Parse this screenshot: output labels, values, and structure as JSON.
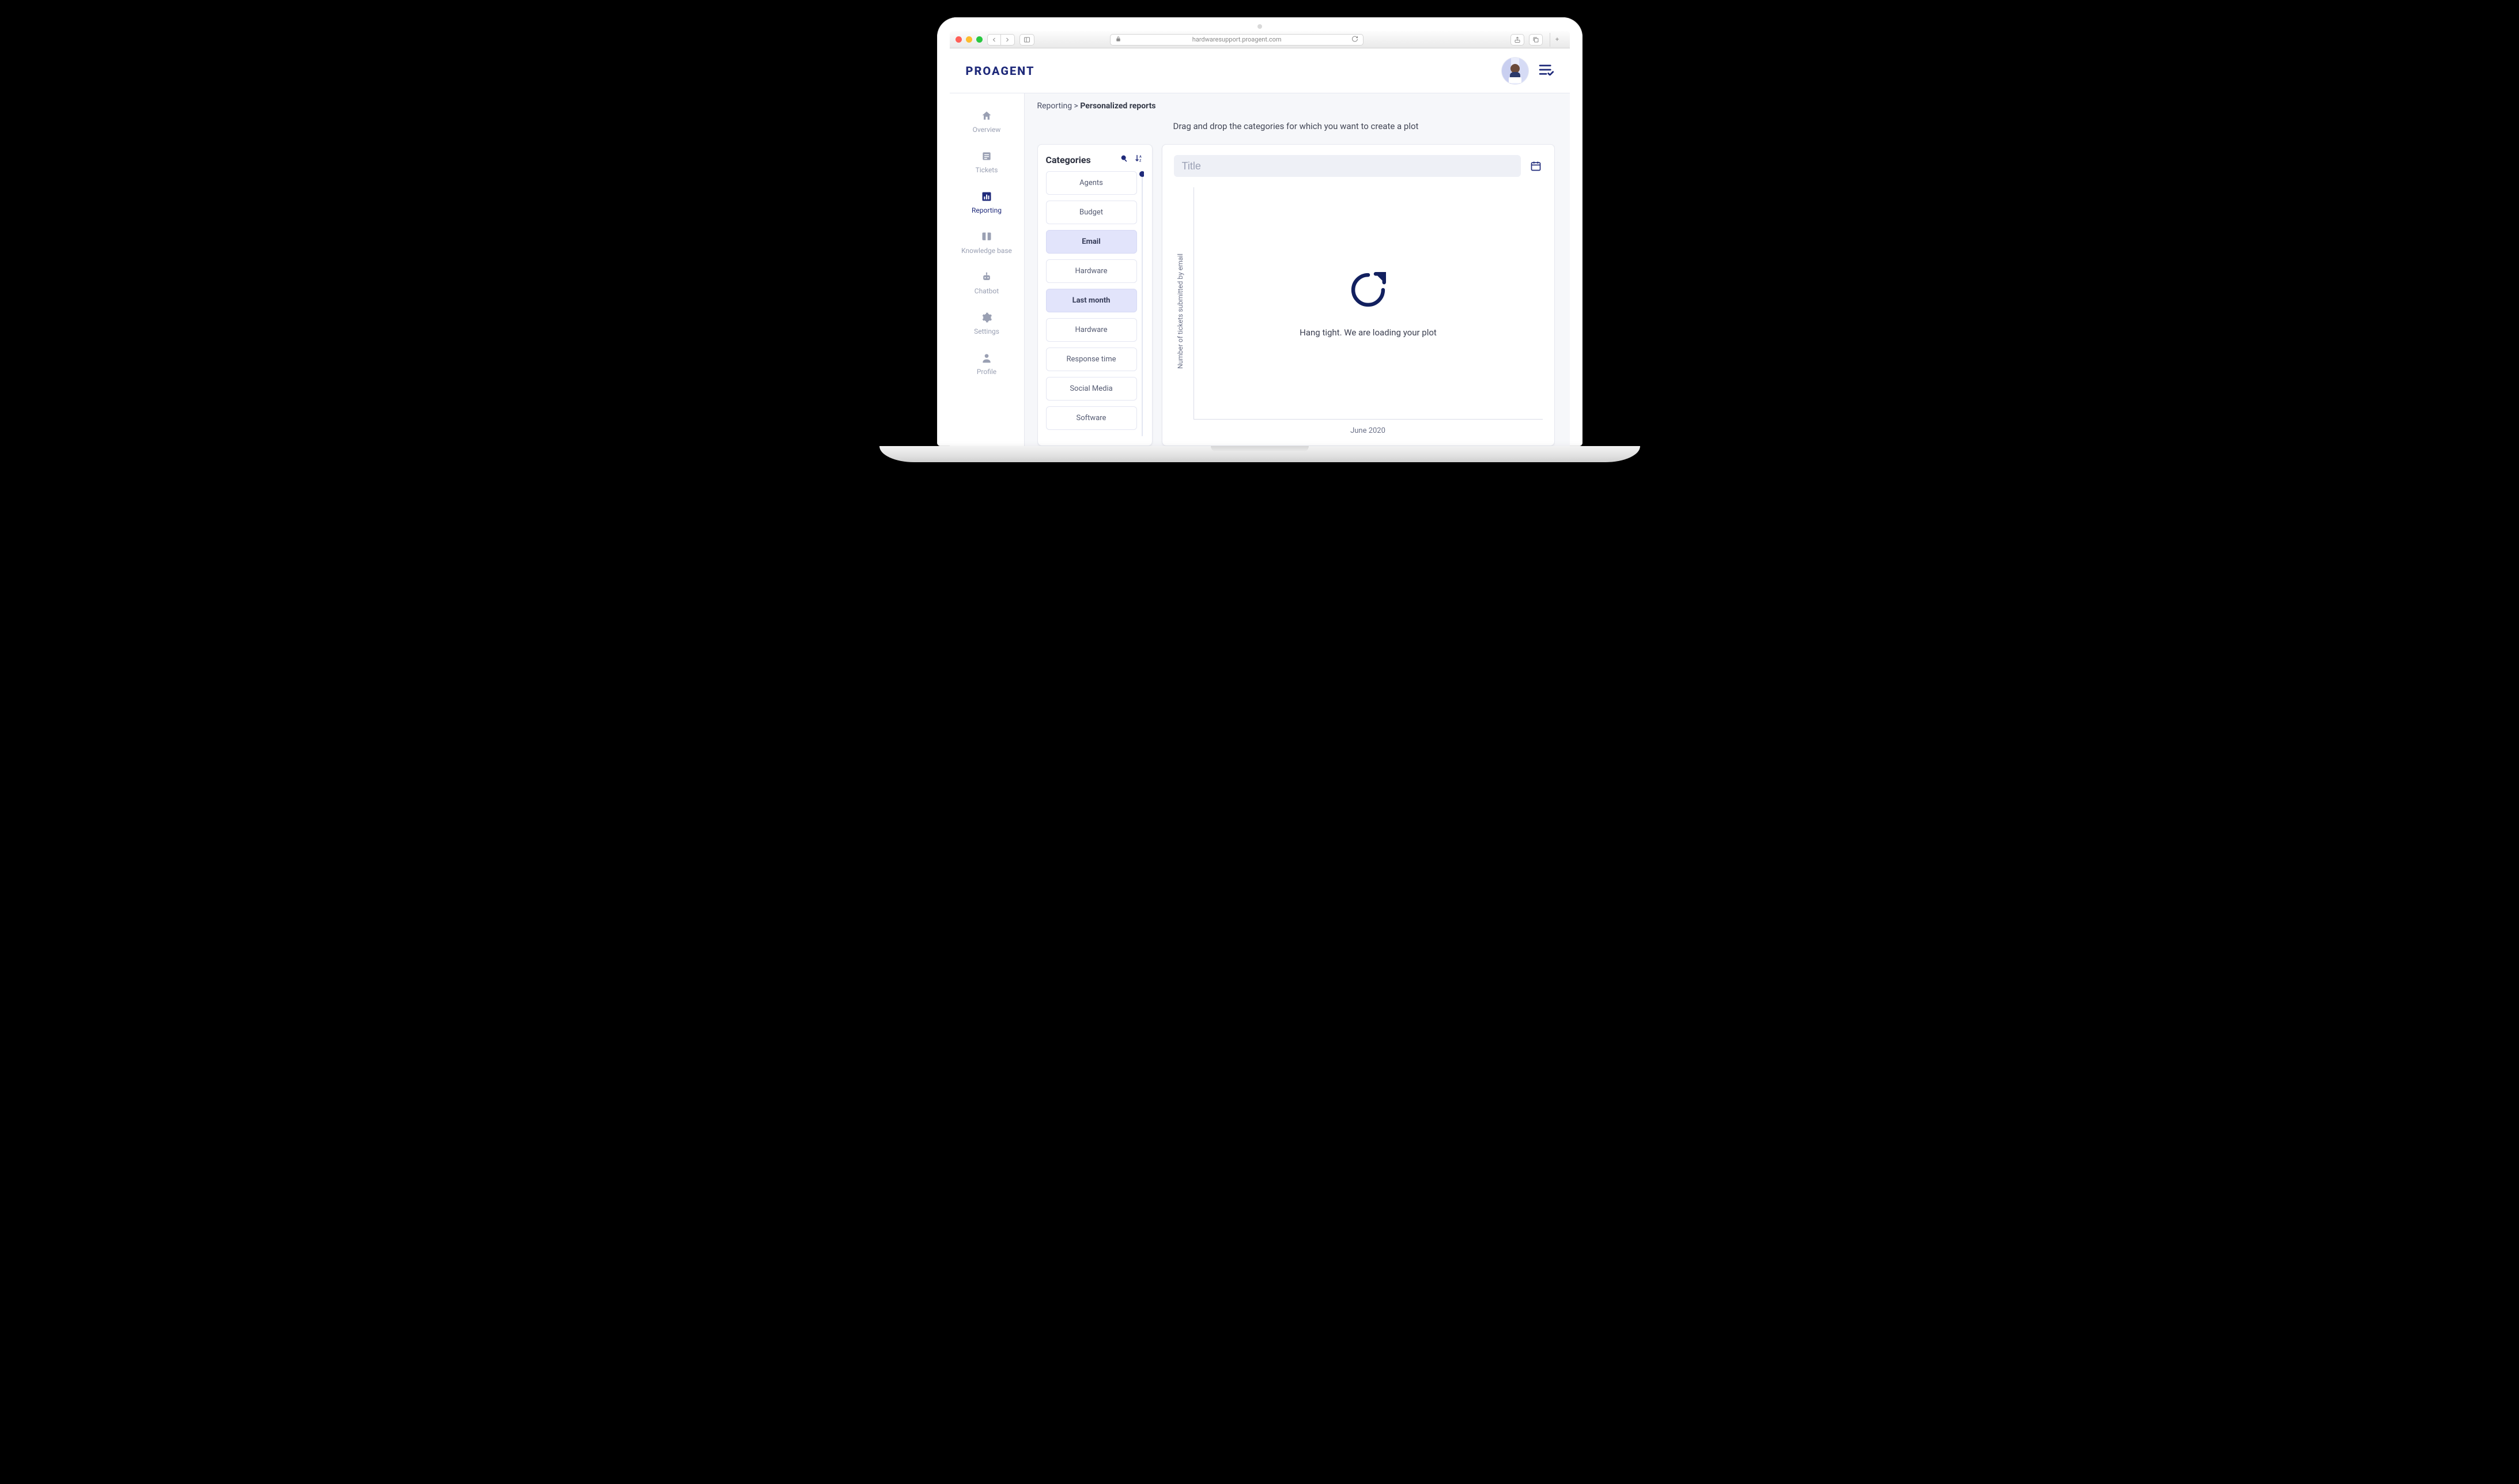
{
  "browser": {
    "url": "hardwaresupport.proagent.com"
  },
  "app": {
    "logo": "PROAGENT"
  },
  "sidebar": {
    "items": [
      {
        "label": "Overview"
      },
      {
        "label": "Tickets"
      },
      {
        "label": "Reporting"
      },
      {
        "label": "Knowledge base"
      },
      {
        "label": "Chatbot"
      },
      {
        "label": "Settings"
      },
      {
        "label": "Profile"
      }
    ]
  },
  "breadcrumb": {
    "root": "Reporting",
    "sep": ">",
    "current": "Personalized reports"
  },
  "instruction": "Drag and drop the categories for which you want to create a plot",
  "categories": {
    "title": "Categories",
    "items": [
      {
        "label": "Agents",
        "selected": false
      },
      {
        "label": "Budget",
        "selected": false
      },
      {
        "label": "Email",
        "selected": true
      },
      {
        "label": "Hardware",
        "selected": false
      },
      {
        "label": "Last month",
        "selected": true
      },
      {
        "label": "Hardware",
        "selected": false
      },
      {
        "label": "Response time",
        "selected": false
      },
      {
        "label": "Social Media",
        "selected": false
      },
      {
        "label": "Software",
        "selected": false
      }
    ]
  },
  "plot": {
    "title_placeholder": "Title",
    "y_label": "Number of tickets submitted by email",
    "x_label": "June 2020",
    "loading_text": "Hang tight. We are loading your plot"
  }
}
